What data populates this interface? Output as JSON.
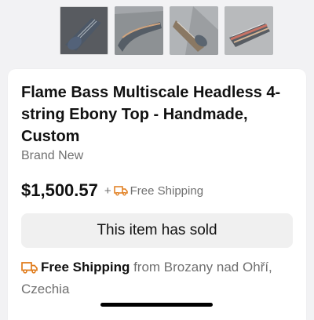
{
  "gallery": {
    "thumbnails": [
      {
        "icon": "guitar-photo-thumbnail-1"
      },
      {
        "icon": "guitar-photo-thumbnail-2"
      },
      {
        "icon": "guitar-photo-thumbnail-3"
      },
      {
        "icon": "guitar-photo-thumbnail-4"
      }
    ]
  },
  "listing": {
    "title": "Flame Bass Multiscale Headless 4-string Ebony Top - Handmade, Custom",
    "condition": "Brand New",
    "price": "$1,500.57",
    "plus_sign": "+",
    "shipping_summary": "Free Shipping",
    "sold_status": "This item has sold",
    "shipping_detail_bold": "Free Shipping",
    "shipping_detail_rest": "from Brozany nad Ohří, Czechia"
  },
  "colors": {
    "accent_truck": "#e07b1a",
    "text_primary": "#111111",
    "text_secondary": "#707070",
    "sold_box_bg": "#f0f0f0"
  }
}
